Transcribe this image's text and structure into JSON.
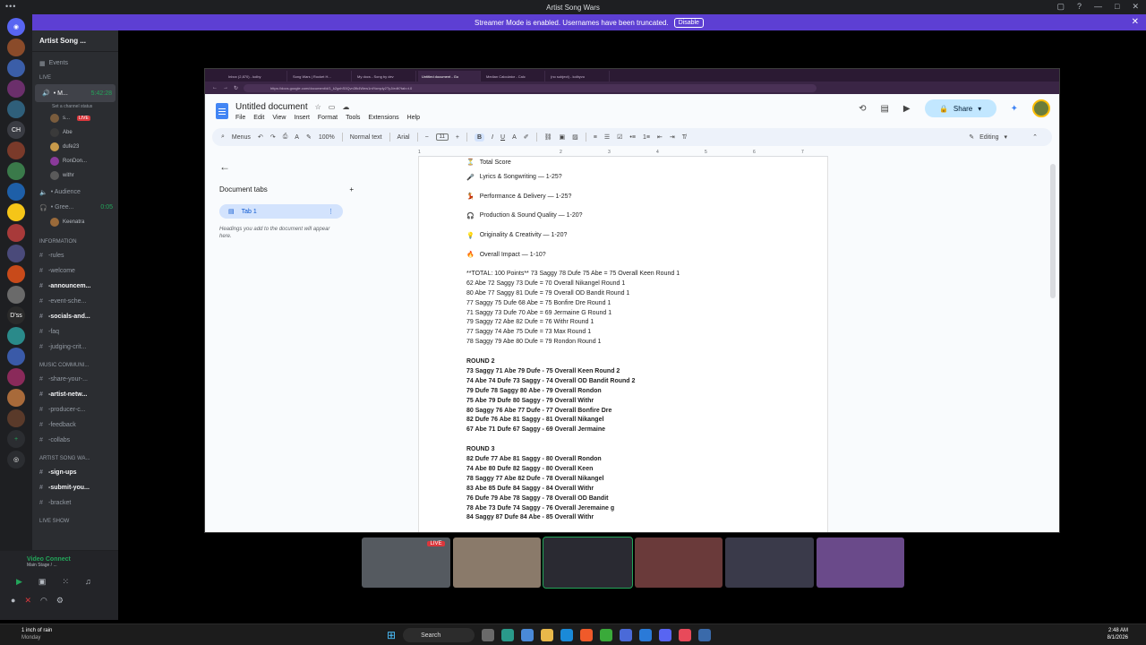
{
  "window": {
    "title": "Artist Song Wars"
  },
  "banner": {
    "text": "Streamer Mode is enabled. Usernames have been truncated.",
    "button": "Disable"
  },
  "servers": [
    "CH",
    "D'ss"
  ],
  "server": {
    "name": "Artist Song ..."
  },
  "channels": {
    "events": "Events",
    "live_header": "LIVE",
    "main_channel": "• M...",
    "main_time": "5:42:28",
    "main_status": "Set a channel status",
    "voice_users": [
      {
        "name": "s...",
        "live": "LIVE"
      },
      {
        "name": "Abe"
      },
      {
        "name": "dufe23"
      },
      {
        "name": "RonDon..."
      },
      {
        "name": "withr"
      }
    ],
    "audience": "• Audience",
    "green_room": "• Gree...",
    "green_time": "0:05",
    "green_user": "Keenatra",
    "info_header": "INFORMATION",
    "info": [
      "-rules",
      "-welcome",
      "-announcem...",
      "-event-sche...",
      "-socials-and...",
      "-faq",
      "-judging-crit..."
    ],
    "music_header": "MUSIC COMMUNI...",
    "music": [
      "-share-your-...",
      "-artist-netw...",
      "-producer-c...",
      "-feedback",
      "-collabs"
    ],
    "asw_header": "ARTIST SONG WA...",
    "asw": [
      "-sign-ups",
      "-submit-you...",
      "-bracket"
    ],
    "live_show_header": "LIVE SHOW"
  },
  "voice_panel": {
    "title": "Video Connect",
    "subtitle": "Main Stage / ..."
  },
  "browser": {
    "tabs": [
      "Untitled document - Go",
      "Median Calculator - Calc",
      "(no subject) - kolbyvo",
      "Song Wars | Rocket H...",
      "Inbox (2,870) - kolby",
      "My docs - Song by dev"
    ],
    "url": "https://docs.google.com/document/d/1_k2gxhS0Qvn3fk4Wew1ntYomply2TyJ/edit?tab=t.0"
  },
  "docs": {
    "title": "Untitled document",
    "menus": [
      "File",
      "Edit",
      "View",
      "Insert",
      "Format",
      "Tools",
      "Extensions",
      "Help"
    ],
    "share": "Share",
    "toolbar": {
      "menus": "Menus",
      "zoom": "100%",
      "style": "Normal text",
      "font": "Arial",
      "size": "11",
      "editing": "Editing"
    },
    "outline": {
      "tabs_title": "Document tabs",
      "tab_label": "Tab 1",
      "hint": "Headings you add to the document will appear here."
    },
    "ruler": [
      "1",
      "2",
      "3",
      "4",
      "5",
      "6",
      "7"
    ],
    "criteria": [
      {
        "icon": "⏳",
        "text": "Total Score"
      },
      {
        "icon": "🎤",
        "text": "Lyrics & Songwriting — 1-25?"
      },
      {
        "icon": "💃",
        "text": "Performance & Delivery — 1-25?"
      },
      {
        "icon": "🎧",
        "text": "Production & Sound Quality — 1-20?"
      },
      {
        "icon": "💡",
        "text": "Originality & Creativity — 1-20?"
      },
      {
        "icon": "🔥",
        "text": "Overall Impact — 1-10?"
      }
    ],
    "round1": [
      "**TOTAL: 100 Points** 73 Saggy 78 Dufe 75 Abe = 75 Overall Keen Round 1",
      "62 Abe 72 Saggy 73 Dufe = 70 Overall Nikangel Round 1",
      "80 Abe 77 Saggy 81 Dufe = 79 Overall OD Bandit Round 1",
      "77 Saggy 75 Dufe 68 Abe = 75 Bonfire Dre Round 1",
      "71 Saggy 73 Dufe 70 Abe = 69 Jermaine G Round 1",
      "79 Saggy 72 Abe 82 Dufe = 76 Withr Round 1",
      "77 Saggy 74 Abe 75 Dufe = 73 Max Round 1",
      "78 Saggy 79 Abe 80 Dufe = 79 Rondon Round 1"
    ],
    "round2_title": "ROUND 2",
    "round2": [
      "73 Saggy 71 Abe 79 Dufe - 75 Overall Keen Round 2",
      "74 Abe 74 Dufe 73 Saggy - 74 Overall OD Bandit Round 2",
      "79 Dufe 78 Saggy 80 Abe - 79 Overall Rondon",
      "75 Abe 79 Dufe 80 Saggy - 79 Overall Withr",
      "80 Saggy 76 Abe 77 Dufe - 77 Overall Bonfire Dre",
      "82 Dufe 76 Abe 81 Saggy - 81 Overall Nikangel",
      "67 Abe 71 Dufe 67 Saggy - 69 Overall Jermaine"
    ],
    "round3_title": "ROUND 3",
    "round3": [
      "82 Dufe 77 Abe 81 Saggy - 80 Overall Rondon",
      "74 Abe 80 Dufe 82 Saggy - 80 Overall Keen",
      "78 Saggy 77 Abe 82 Dufe - 78 Overall Nikangel",
      "83 Abe 85 Dufe 84 Saggy - 84 Overall Withr",
      "76 Dufe 79 Abe 78 Saggy - 78 Overall OD Bandit",
      "78 Abe 73 Dufe 74 Saggy - 76 Overall Jeremaine g",
      "84 Saggy 87 Dufe 84 Abe - 85 Overall Withr"
    ]
  },
  "stream_tiles": [
    {
      "live": "LIVE"
    },
    {},
    {},
    {},
    {},
    {}
  ],
  "taskbar": {
    "weather": "1 inch of rain",
    "weather_sub": "Monday",
    "search": "Search",
    "time": "2:48 AM",
    "date": "8/1/2026"
  }
}
